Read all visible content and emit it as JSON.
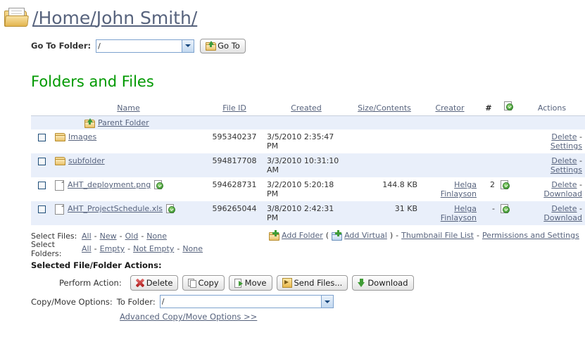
{
  "breadcrumb": {
    "icon": "folder-open-icon",
    "root": "/",
    "home": "Home/",
    "user": "John Smith/"
  },
  "goto": {
    "label": "Go To Folder:",
    "value": "/",
    "options": [
      "/"
    ],
    "button_label": "Go To",
    "button_icon": "folder-go-icon"
  },
  "section": {
    "title": "Folders and Files"
  },
  "table": {
    "headers": {
      "name": "Name",
      "file_id": "File ID",
      "created": "Created",
      "size": "Size/Contents",
      "creator": "Creator",
      "count_icon": "hash-download-count-icon",
      "doc_icon": "document-approved-icon",
      "actions": "Actions"
    },
    "parent_row": {
      "label": "Parent Folder",
      "icon": "folder-up-icon"
    },
    "rows": [
      {
        "icon": "folder-icon",
        "name": "Images",
        "file_id": "595340237",
        "created": "3/5/2010 2:35:47 PM",
        "size": "",
        "creator": "",
        "count": "",
        "has_doc_icon": false,
        "has_name_doc_icon": false,
        "actions": [
          "Delete",
          "Settings"
        ]
      },
      {
        "icon": "folder-icon",
        "name": "subfolder",
        "file_id": "594817708",
        "created": "3/3/2010 10:31:10 AM",
        "size": "",
        "creator": "",
        "count": "",
        "has_doc_icon": false,
        "has_name_doc_icon": false,
        "actions": [
          "Delete",
          "Settings"
        ]
      },
      {
        "icon": "document-icon",
        "name": "AHT_deployment.png",
        "file_id": "594628731",
        "created": "3/2/2010 5:20:18 PM",
        "size": "144.8 KB",
        "creator": "Helga Finlayson",
        "count": "2",
        "has_doc_icon": true,
        "has_name_doc_icon": true,
        "actions": [
          "Delete",
          "Download"
        ]
      },
      {
        "icon": "document-icon",
        "name": "AHT_ProjectSchedule.xls",
        "file_id": "596265044",
        "created": "3/8/2010 2:42:31 PM",
        "size": "31 KB",
        "creator": "Helga Finlayson",
        "count": "-",
        "has_doc_icon": true,
        "has_name_doc_icon": true,
        "actions": [
          "Delete",
          "Download"
        ]
      }
    ],
    "action_separator": "-"
  },
  "select_rows": {
    "files_label": "Select Files:",
    "files_links": [
      "All",
      "New",
      "Old",
      "None"
    ],
    "folders_label": "Select Folders:",
    "folders_links": [
      "All",
      "Empty",
      "Not Empty",
      "None"
    ],
    "separator": "-"
  },
  "right_links": {
    "add_folder": "Add Folder",
    "open_paren": "(",
    "add_virtual": "Add Virtual",
    "close_paren": ")",
    "sep": "-",
    "thumbnail": "Thumbnail File List",
    "permissions": "Permissions and Settings",
    "add_folder_icon": "folder-add-icon",
    "add_virtual_icon": "folder-virtual-add-icon"
  },
  "bottom": {
    "title": "Selected File/Folder Actions:",
    "perform_label": "Perform Action:",
    "buttons": [
      {
        "label": "Delete",
        "icon": "delete-x-icon"
      },
      {
        "label": "Copy",
        "icon": "copy-icon"
      },
      {
        "label": "Move",
        "icon": "move-icon"
      },
      {
        "label": "Send Files...",
        "icon": "send-icon"
      },
      {
        "label": "Download",
        "icon": "download-arrow-icon"
      }
    ],
    "copymove_label": "Copy/Move Options:",
    "to_folder_label": "To Folder:",
    "to_folder_value": "/",
    "to_folder_options": [
      "/"
    ],
    "advanced_link": "Advanced Copy/Move Options >>"
  },
  "colors": {
    "link": "#57637d",
    "heading_green": "#009900",
    "row_alt": "#e9effa",
    "header_rule": "#c7cfdd"
  }
}
